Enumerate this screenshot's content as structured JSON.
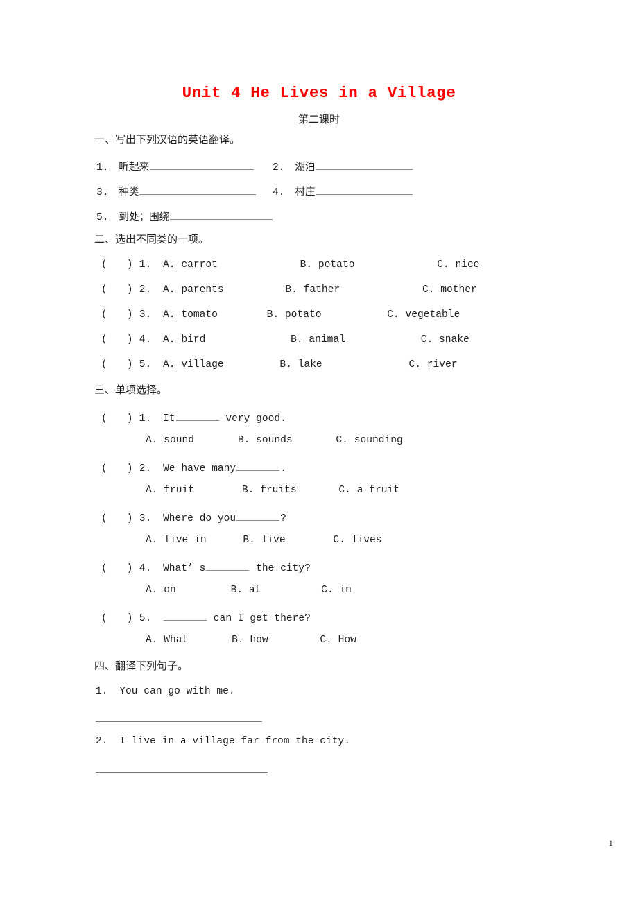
{
  "title": "Unit 4 He Lives in a Village",
  "subtitle": "第二课时",
  "page_number": "1",
  "accent_color": "#ff0000",
  "sections": [
    {
      "heading": "一、写出下列汉语的英语翻译。",
      "items": [
        {
          "num": "1.",
          "text": "听起来"
        },
        {
          "num": "2.",
          "text": "湖泊"
        },
        {
          "num": "3.",
          "text": "种类"
        },
        {
          "num": "4.",
          "text": "村庄"
        },
        {
          "num": "5.",
          "text": "到处；围绕"
        }
      ]
    },
    {
      "heading": "二、选出不同类的一项。",
      "items": [
        {
          "num": "1.",
          "a": "A. carrot",
          "b": "B. potato",
          "c": "C. nice"
        },
        {
          "num": "2.",
          "a": "A. parents",
          "b": "B. father",
          "c": "C. mother"
        },
        {
          "num": "3.",
          "a": "A. tomato",
          "b": "B. potato",
          "c": "C. vegetable"
        },
        {
          "num": "4.",
          "a": "A. bird",
          "b": "B. animal",
          "c": "C. snake"
        },
        {
          "num": "5.",
          "a": "A. village",
          "b": "B. lake",
          "c": "C. river"
        }
      ]
    },
    {
      "heading": "三、单项选择。",
      "items": [
        {
          "num": "1.",
          "stem_before": "It",
          "stem_after": " very good.",
          "a": "A. sound",
          "b": "B. sounds",
          "c": "C. sounding"
        },
        {
          "num": "2.",
          "stem_before": "We have many",
          "stem_after": ".",
          "a": "A. fruit",
          "b": "B. fruits",
          "c": "C. a fruit"
        },
        {
          "num": "3.",
          "stem_before": "Where do you",
          "stem_after": "?",
          "a": "A. live in",
          "b": "B. live",
          "c": "C. lives"
        },
        {
          "num": "4.",
          "stem_before": "What’ s",
          "stem_after": " the city?",
          "a": "A. on",
          "b": "B. at",
          "c": "C. in"
        },
        {
          "num": "5.",
          "stem_before": "",
          "stem_after": " can I get there?",
          "a": "A. What",
          "b": "B. how",
          "c": "C. How"
        }
      ]
    },
    {
      "heading": "四、翻译下列句子。",
      "items": [
        {
          "num": "1.",
          "sentence": "You can go with me."
        },
        {
          "num": "2.",
          "sentence": "I live in a village far from the city."
        }
      ]
    }
  ]
}
